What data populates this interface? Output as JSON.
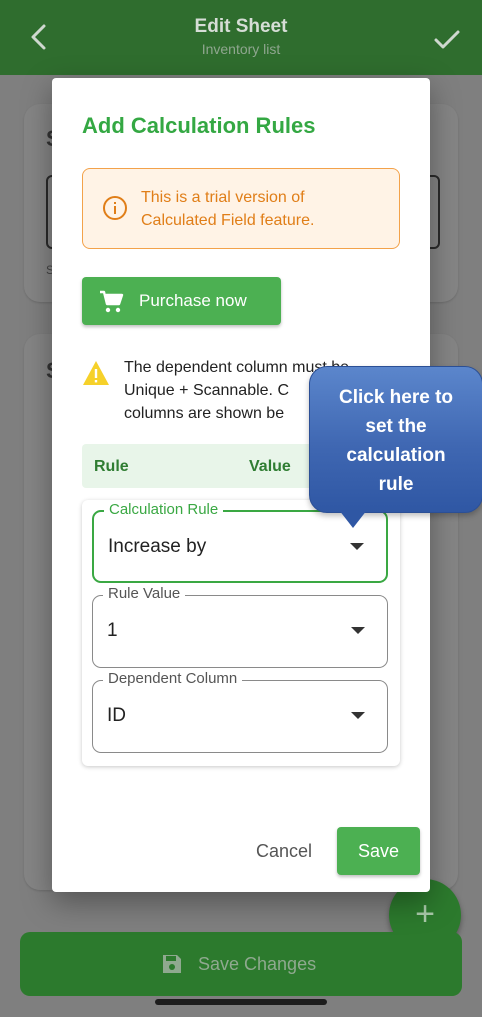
{
  "header": {
    "title": "Edit Sheet",
    "subtitle": "Inventory list"
  },
  "dialog": {
    "title": "Add Calculation Rules",
    "trial_notice": "This is a trial version of Calculated Field feature.",
    "purchase_label": "Purchase now",
    "warning_lines": [
      "The dependent column must be",
      "Unique + Scannable. C",
      "columns are shown be"
    ],
    "table_header": {
      "rule": "Rule",
      "value": "Value"
    },
    "fields": {
      "calculation_rule": {
        "label": "Calculation Rule",
        "value": "Increase by"
      },
      "rule_value": {
        "label": "Rule Value",
        "value": "1"
      },
      "dependent_column": {
        "label": "Dependent Column",
        "value": "ID"
      }
    },
    "cancel_label": "Cancel",
    "save_label": "Save"
  },
  "callout": {
    "lines": [
      "Click here to",
      "set the",
      "calculation",
      "rule"
    ]
  },
  "footer": {
    "save_changes_label": "Save Changes",
    "fab_icon": "+"
  },
  "background": {
    "card1_letter": "S",
    "card1_small": "S",
    "card2_letter": "S"
  },
  "colors": {
    "primary": "#4cb052",
    "appbar": "#2f6d2e",
    "warning": "#f3a24a",
    "callout": "#3f67b2"
  }
}
